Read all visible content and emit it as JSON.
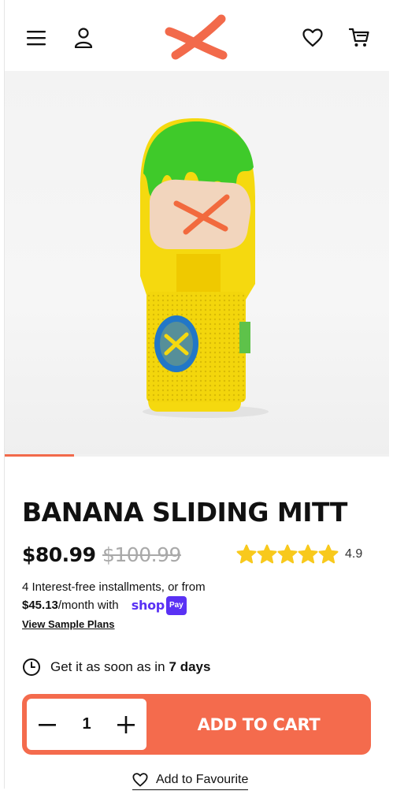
{
  "header": {
    "icons": [
      "menu-icon",
      "account-icon",
      "brand-logo",
      "heart-icon",
      "cart-icon"
    ]
  },
  "product": {
    "title": "BANANA SLIDING MITT",
    "price": "$80.99",
    "compare_price": "$100.99",
    "rating": {
      "stars": 5,
      "value": "4.9"
    },
    "gallery": {
      "progress_fraction": 0.18
    }
  },
  "installments": {
    "text_prefix": "4 Interest-free installments, or from",
    "amount": "$45.13",
    "text_suffix": "/month with",
    "shop_word": "shop",
    "pay_badge": "Pay",
    "view_plans": "View Sample Plans"
  },
  "delivery": {
    "prefix": "Get it as soon as in",
    "days": "7 days"
  },
  "cart": {
    "quantity": "1",
    "add_label": "ADD TO CART"
  },
  "favourite": {
    "label": "Add to Favourite"
  },
  "colors": {
    "accent": "#f46b4d",
    "star": "#f8c91c",
    "shop_pay": "#5a31f4",
    "mitt_yellow": "#f5d90f",
    "mitt_green": "#3fca2a"
  }
}
